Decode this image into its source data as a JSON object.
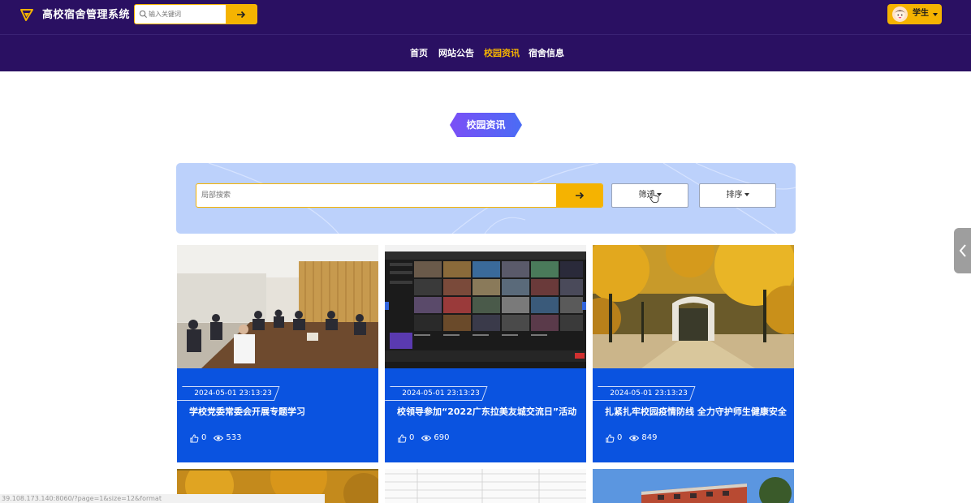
{
  "app": {
    "title": "高校宿舍管理系统"
  },
  "header": {
    "search_placeholder": "输入关键词",
    "user_name": "学生"
  },
  "nav": {
    "items": [
      {
        "label": "首页",
        "active": false
      },
      {
        "label": "网站公告",
        "active": false
      },
      {
        "label": "校园资讯",
        "active": true
      },
      {
        "label": "宿舍信息",
        "active": false
      }
    ]
  },
  "section": {
    "title": "校园资讯"
  },
  "filter_panel": {
    "search_placeholder": "局部搜索",
    "filter_label": "筛选",
    "sort_label": "排序"
  },
  "cards": [
    {
      "date": "2024-05-01 23:13:23",
      "title": "学校党委常委会开展专题学习",
      "likes": "0",
      "views": "533",
      "image": "meeting-room-photo"
    },
    {
      "date": "2024-05-01 23:13:23",
      "title": "校领导参加“2022广东拉美友城交流日”活动",
      "likes": "0",
      "views": "690",
      "image": "video-conference-screenshot"
    },
    {
      "date": "2024-05-01 23:13:23",
      "title": "扎紧扎牢校园疫情防线 全力守护师生健康安全",
      "likes": "0",
      "views": "849",
      "image": "campus-gate-autumn-photo"
    }
  ],
  "status_bar": {
    "text": "39.108.173.140:8060/?page=1&size=12&format"
  },
  "colors": {
    "header_bg": "#2a1062",
    "accent": "#f5b301",
    "card_bg": "#0a53e0",
    "panel_bg": "#bcd1fb"
  }
}
